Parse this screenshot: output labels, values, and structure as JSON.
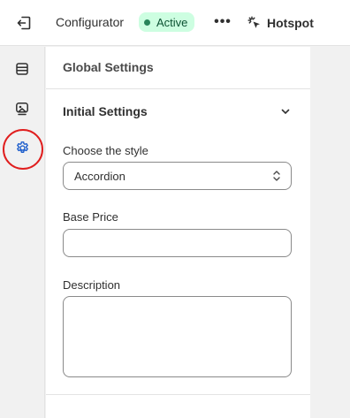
{
  "header": {
    "app_title": "Configurator",
    "status": "Active",
    "more_label": "•••",
    "hotspot_label": "Hotspot"
  },
  "rail": {
    "items": [
      {
        "icon": "layout-icon"
      },
      {
        "icon": "image-edit-icon"
      },
      {
        "icon": "gear-icon",
        "selected": true
      }
    ]
  },
  "panel": {
    "title": "Global Settings",
    "section_title": "Initial Settings",
    "style_label": "Choose the style",
    "style_value": "Accordion",
    "price_label": "Base Price",
    "price_value": "",
    "description_label": "Description",
    "description_value": ""
  },
  "colors": {
    "accent_blue": "#1f5fcc",
    "badge_bg": "#cdfee1",
    "badge_dot": "#29845a",
    "highlight_ring": "#e01e1e"
  }
}
